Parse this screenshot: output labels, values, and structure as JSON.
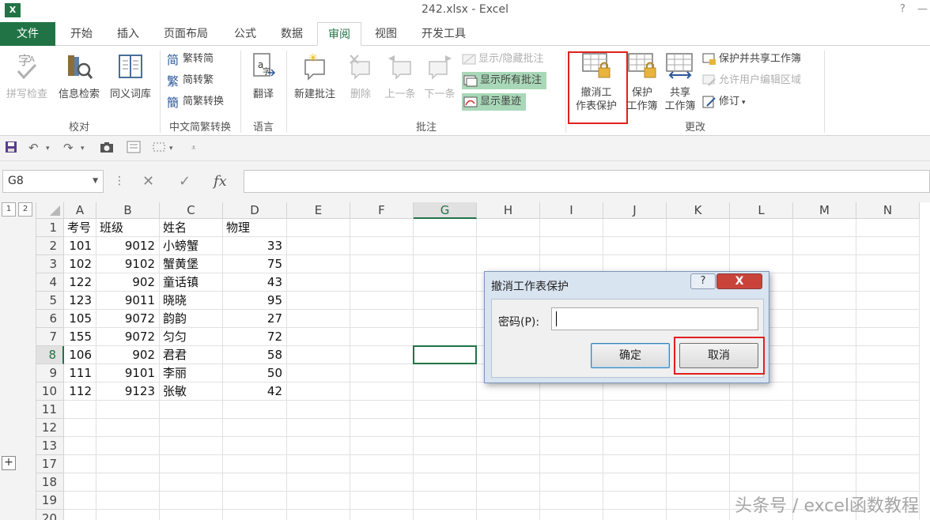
{
  "window": {
    "app_icon": "X",
    "title": "242.xlsx - Excel",
    "help": "?",
    "minimize": "—"
  },
  "tabs": [
    "文件",
    "开始",
    "插入",
    "页面布局",
    "公式",
    "数据",
    "审阅",
    "视图",
    "开发工具"
  ],
  "active_tab": "审阅",
  "ribbon": {
    "proofing": {
      "spelling": "拼写检查",
      "research": "信息检索",
      "thesaurus": "同义词库",
      "group": "校对"
    },
    "chinese": {
      "to_simplified": "繁转简",
      "to_traditional": "简转繁",
      "convert": "简繁转换",
      "group": "中文简繁转换"
    },
    "language": {
      "translate": "翻译",
      "group": "语言"
    },
    "comments": {
      "new": "新建批注",
      "delete": "删除",
      "previous": "上一条",
      "next": "下一条",
      "show_hide": "显示/隐藏批注",
      "show_all": "显示所有批注",
      "show_ink": "显示墨迹",
      "group": "批注"
    },
    "changes": {
      "unprotect_sheet_1": "撤消工",
      "unprotect_sheet_2": "作表保护",
      "protect_wb_1": "保护",
      "protect_wb_2": "工作簿",
      "share_wb_1": "共享",
      "share_wb_2": "工作簿",
      "protect_share": "保护并共享工作簿",
      "allow_edit": "允许用户编辑区域",
      "track": "修订",
      "group": "更改"
    }
  },
  "formula_bar": {
    "name_box": "G8",
    "fx": "fx"
  },
  "outline": {
    "level1": "1",
    "level2": "2",
    "expand": "+"
  },
  "columns": [
    "A",
    "B",
    "C",
    "D",
    "E",
    "F",
    "G",
    "H",
    "I",
    "J",
    "K",
    "L",
    "M",
    "N"
  ],
  "rows": [
    "1",
    "2",
    "3",
    "4",
    "5",
    "6",
    "7",
    "8",
    "9",
    "10",
    "11",
    "12",
    "13",
    "17",
    "18",
    "19",
    "20"
  ],
  "selected": {
    "column": "G",
    "row": "8"
  },
  "sheet": {
    "headers": [
      "考号",
      "班级",
      "姓名",
      "物理"
    ],
    "records": [
      [
        "101",
        "9012",
        "小螃蟹",
        "33"
      ],
      [
        "102",
        "9102",
        "蟹黄堡",
        "75"
      ],
      [
        "122",
        "902",
        "童话镇",
        "43"
      ],
      [
        "123",
        "9011",
        "晓晓",
        "95"
      ],
      [
        "105",
        "9072",
        "韵韵",
        "27"
      ],
      [
        "155",
        "9072",
        "匀匀",
        "72"
      ],
      [
        "106",
        "902",
        "君君",
        "58"
      ],
      [
        "111",
        "9101",
        "李丽",
        "50"
      ],
      [
        "112",
        "9123",
        "张敏",
        "42"
      ]
    ]
  },
  "dialog": {
    "title": "撤消工作表保护",
    "help": "?",
    "close": "X",
    "password_label": "密码(P):",
    "password_value": "",
    "ok": "确定",
    "cancel": "取消"
  },
  "watermark": "头条号 / excel函数教程",
  "colors": {
    "accent": "#217346",
    "highlight": "#e02020",
    "show_comment_bg": "#a9d8b8"
  }
}
